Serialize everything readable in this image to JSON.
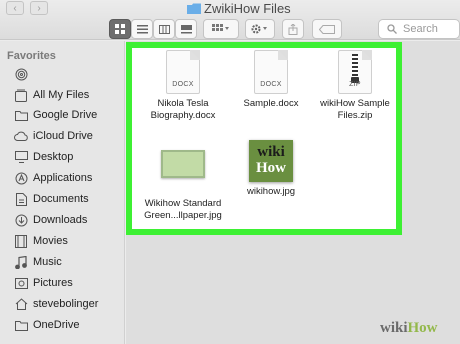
{
  "window": {
    "title": "ZwikiHow Files"
  },
  "nav": {
    "back": "‹",
    "forward": "›"
  },
  "toolbar": {
    "search_placeholder": "Search"
  },
  "sidebar": {
    "heading": "Favorites",
    "items": [
      {
        "label": "",
        "icon": "airdrop-icon"
      },
      {
        "label": "All My Files",
        "icon": "all-files-icon"
      },
      {
        "label": "Google Drive",
        "icon": "folder-icon"
      },
      {
        "label": "iCloud Drive",
        "icon": "cloud-icon"
      },
      {
        "label": "Desktop",
        "icon": "desktop-icon"
      },
      {
        "label": "Applications",
        "icon": "applications-icon"
      },
      {
        "label": "Documents",
        "icon": "documents-icon"
      },
      {
        "label": "Downloads",
        "icon": "downloads-icon"
      },
      {
        "label": "Movies",
        "icon": "movies-icon"
      },
      {
        "label": "Music",
        "icon": "music-icon"
      },
      {
        "label": "Pictures",
        "icon": "pictures-icon"
      },
      {
        "label": "stevebolinger",
        "icon": "home-icon"
      },
      {
        "label": "OneDrive",
        "icon": "folder-icon"
      }
    ]
  },
  "files": [
    {
      "name": "Nikola Tesla\nBiography.docx",
      "ext": "DOCX",
      "kind": "docx"
    },
    {
      "name": "Sample.docx",
      "ext": "DOCX",
      "kind": "docx"
    },
    {
      "name": "wikiHow Sample\nFiles.zip",
      "ext": "ZIP",
      "kind": "zip"
    },
    {
      "name": "Wikihow Standard\nGreen...llpaper.jpg",
      "ext": "",
      "kind": "image"
    },
    {
      "name": "wikihow.jpg",
      "ext": "",
      "kind": "wiki"
    }
  ],
  "thumb_text": {
    "line1": "wiki",
    "line2": "How"
  },
  "watermark": {
    "part1": "wiki",
    "part2": "How"
  },
  "colors": {
    "highlight_border": "#3df033",
    "brand_green": "#93b84b"
  }
}
